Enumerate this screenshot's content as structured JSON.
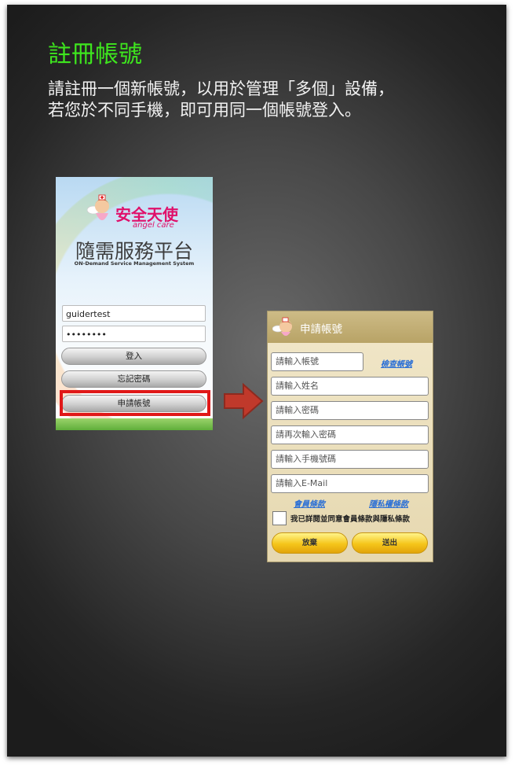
{
  "slide": {
    "title": "註冊帳號",
    "description_lines": [
      "請註冊一個新帳號，以用於管理「多個」設備，",
      "若您於不同手機，即可用同一個帳號登入。"
    ]
  },
  "login_screen": {
    "brand": "安全天使",
    "brand_sub": "angel care",
    "platform_title": "隨需服務平台",
    "platform_subtitle": "ON-Demand Service Management System",
    "username_value": "guidertest",
    "password_value": "••••••••",
    "login_button": "登入",
    "forgot_button": "忘記密碼",
    "register_button": "申請帳號",
    "highlight_color": "#e01818"
  },
  "register_dialog": {
    "title": "申請帳號",
    "account_placeholder": "請輸入帳號",
    "check_account_link": "檢查帳號",
    "name_placeholder": "請輸入姓名",
    "password_placeholder": "請輸入密碼",
    "password_confirm_placeholder": "請再次輸入密碼",
    "phone_placeholder": "請輸入手機號碼",
    "email_placeholder": "請輸入E-Mail",
    "member_terms_link": "會員條款",
    "privacy_terms_link": "隱私權條款",
    "agree_text": "我已詳閱並同意會員條款與隱私條款",
    "cancel_button": "放棄",
    "submit_button": "送出"
  },
  "colors": {
    "title_green": "#3ee61e",
    "arrow_red": "#c0392b",
    "link_blue": "#2a6fd6"
  }
}
